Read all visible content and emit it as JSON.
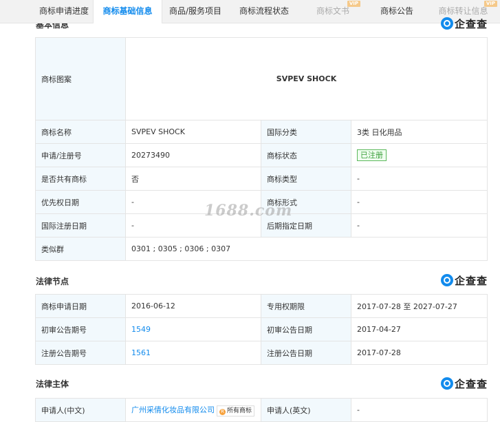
{
  "tabs": [
    {
      "label": "商标申请进度",
      "vip": ""
    },
    {
      "label": "商标基础信息",
      "vip": ""
    },
    {
      "label": "商品/服务项目",
      "vip": ""
    },
    {
      "label": "商标流程状态",
      "vip": ""
    },
    {
      "label": "商标文书",
      "vip": "VIP"
    },
    {
      "label": "商标公告",
      "vip": ""
    },
    {
      "label": "商标转让信息",
      "vip": "VIP"
    }
  ],
  "basic": {
    "title": "基本信息",
    "logo": "企查查",
    "mark_label": "商标图案",
    "mark_text": "SVPEV SHOCK",
    "rows": [
      [
        "商标名称",
        "SVPEV SHOCK",
        "国际分类",
        "3类 日化用品"
      ],
      [
        "申请/注册号",
        "20273490",
        "商标状态",
        "已注册"
      ],
      [
        "是否共有商标",
        "否",
        "商标类型",
        "-"
      ],
      [
        "优先权日期",
        "-",
        "商标形式",
        "-"
      ],
      [
        "国际注册日期",
        "-",
        "后期指定日期",
        "-"
      ]
    ],
    "similar_label": "类似群",
    "similar_value": "0301 ; 0305 ; 0306 ; 0307"
  },
  "legal": {
    "title": "法律节点",
    "logo": "企查查",
    "rows": [
      [
        "商标申请日期",
        "2016-06-12",
        "专用权期限",
        "2017-07-28 至 2027-07-27"
      ],
      [
        "初审公告期号",
        "1549",
        "初审公告日期",
        "2017-04-27"
      ],
      [
        "注册公告期号",
        "1561",
        "注册公告日期",
        "2017-07-28"
      ]
    ]
  },
  "subject": {
    "title": "法律主体",
    "logo": "企查查",
    "applicant_cn_label": "申请人(中文)",
    "applicant_cn": "广州采倩化妆品有限公司",
    "owned_label": "所有商标",
    "applicant_en_label": "申请人(英文)",
    "applicant_en": "-"
  },
  "watermark": "1688.com",
  "colors": {
    "accent": "#128bed",
    "label_bg": "#f2f9fd",
    "status_green": "#3a9d3a",
    "vip": "#f5c98a"
  }
}
